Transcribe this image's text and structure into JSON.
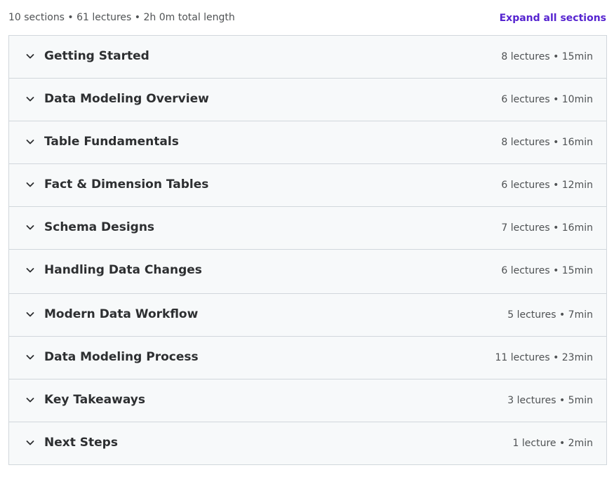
{
  "header": {
    "summary": "10 sections • 61 lectures • 2h 0m total length",
    "expand_all_label": "Expand all sections"
  },
  "icons": {
    "section_toggle": "chevron-down-icon"
  },
  "colors": {
    "accent": "#5624d0",
    "row_background": "#f7f9fa",
    "border": "#d1d7dc",
    "text": "#2d2f31",
    "muted_text": "#4f5254"
  },
  "sections": [
    {
      "title": "Getting Started",
      "meta": "8 lectures • 15min"
    },
    {
      "title": "Data Modeling Overview",
      "meta": "6 lectures • 10min"
    },
    {
      "title": "Table Fundamentals",
      "meta": "8 lectures • 16min"
    },
    {
      "title": "Fact & Dimension Tables",
      "meta": "6 lectures • 12min"
    },
    {
      "title": "Schema Designs",
      "meta": "7 lectures • 16min"
    },
    {
      "title": "Handling Data Changes",
      "meta": "6 lectures • 15min"
    },
    {
      "title": "Modern Data Workflow",
      "meta": "5 lectures • 7min"
    },
    {
      "title": "Data Modeling Process",
      "meta": "11 lectures • 23min"
    },
    {
      "title": "Key Takeaways",
      "meta": "3 lectures • 5min"
    },
    {
      "title": "Next Steps",
      "meta": "1 lecture • 2min"
    }
  ]
}
